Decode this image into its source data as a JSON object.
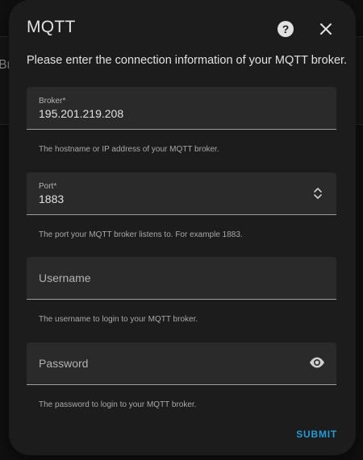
{
  "background": {
    "partial_text": "Br"
  },
  "dialog": {
    "title": "MQTT",
    "intro": "Please enter the connection information of your MQTT broker.",
    "fields": {
      "broker": {
        "label": "Broker*",
        "value": "195.201.219.208",
        "helper": "The hostname or IP address of your MQTT broker."
      },
      "port": {
        "label": "Port*",
        "value": "1883",
        "helper": "The port your MQTT broker listens to. For example 1883."
      },
      "username": {
        "placeholder": "Username",
        "helper": "The username to login to your MQTT broker."
      },
      "password": {
        "placeholder": "Password",
        "helper": "The password to login to your MQTT broker."
      }
    },
    "submit_label": "SUBMIT",
    "icons": {
      "help": "help-icon",
      "close": "close-icon",
      "stepper": "stepper-icon",
      "visibility": "eye-icon"
    },
    "colors": {
      "accent": "#1e9bdc",
      "surface": "#1c1c1c",
      "field": "#2a2a2a"
    }
  }
}
